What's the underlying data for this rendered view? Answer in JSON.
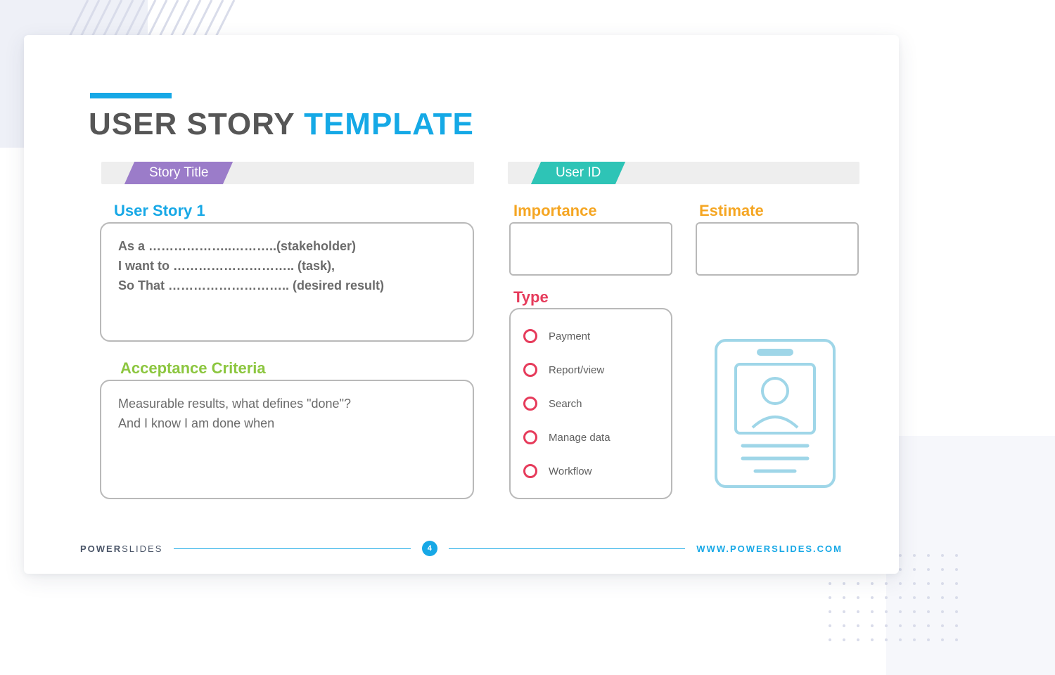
{
  "title": {
    "main": "USER STORY",
    "accent": "TEMPLATE"
  },
  "ribbons": {
    "storyTitle": "Story Title",
    "userId": "User ID"
  },
  "labels": {
    "story1": "User Story 1",
    "accept": "Acceptance Criteria",
    "importance": "Importance",
    "estimate": "Estimate",
    "type": "Type"
  },
  "storyLines": {
    "l1": "As a ………………..………..(stakeholder)",
    "l2": "I want to ……………………….. (task),",
    "l3": "So That ……………………….. (desired result)"
  },
  "acceptLines": {
    "l1": "Measurable results, what defines \"done\"?",
    "l2": "And I know I am done  when"
  },
  "types": {
    "t1": "Payment",
    "t2": "Report/view",
    "t3": "Search",
    "t4": "Manage data",
    "t5": "Workflow"
  },
  "footer": {
    "brand1": "POWER",
    "brand2": "SLIDES",
    "page": "4",
    "url": "WWW.POWERSLIDES.COM"
  }
}
